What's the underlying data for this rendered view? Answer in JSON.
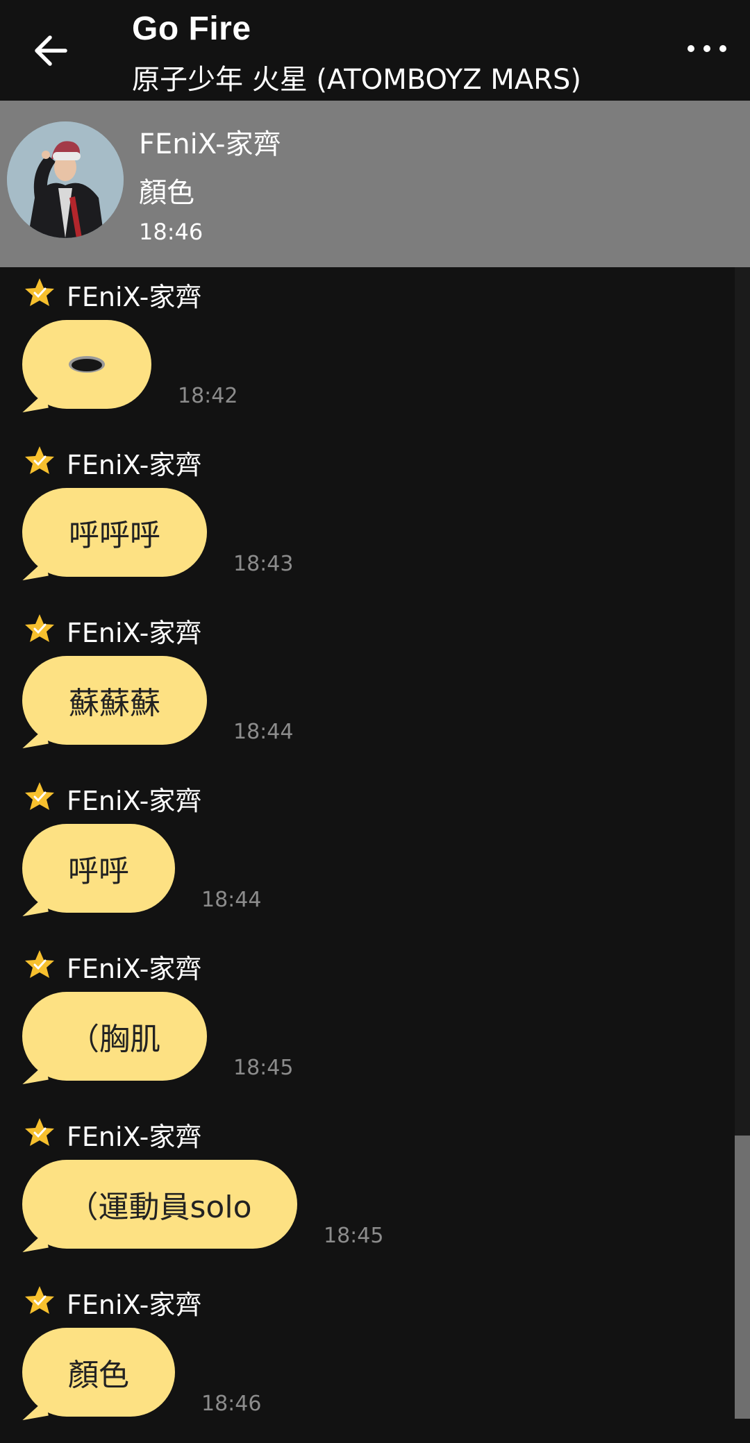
{
  "header": {
    "title": "Go Fire",
    "subtitle": "原子少年 火星 (ATOMBOYZ MARS)",
    "back_icon": "arrow-left-icon",
    "more_icon": "more-horizontal-icon"
  },
  "pinned": {
    "name": "FEniX-家齊",
    "text": "顏色",
    "time": "18:46"
  },
  "messages": [
    {
      "sender": "FEniX-家齊",
      "text": "",
      "time": "18:42"
    },
    {
      "sender": "FEniX-家齊",
      "text": "呼呼呼",
      "time": "18:43"
    },
    {
      "sender": "FEniX-家齊",
      "text": "蘇蘇蘇",
      "time": "18:44"
    },
    {
      "sender": "FEniX-家齊",
      "text": "呼呼",
      "time": "18:44"
    },
    {
      "sender": "FEniX-家齊",
      "text": "（胸肌",
      "time": "18:45"
    },
    {
      "sender": "FEniX-家齊",
      "text": "（運動員solo",
      "time": "18:45"
    },
    {
      "sender": "FEniX-家齊",
      "text": "顏色",
      "time": "18:46"
    }
  ],
  "colors": {
    "background": "#121212",
    "bubble": "#fde183",
    "pinned_bg": "#7d7d7d",
    "star": "#f7c02e",
    "timestamp": "#8c8c8c"
  }
}
